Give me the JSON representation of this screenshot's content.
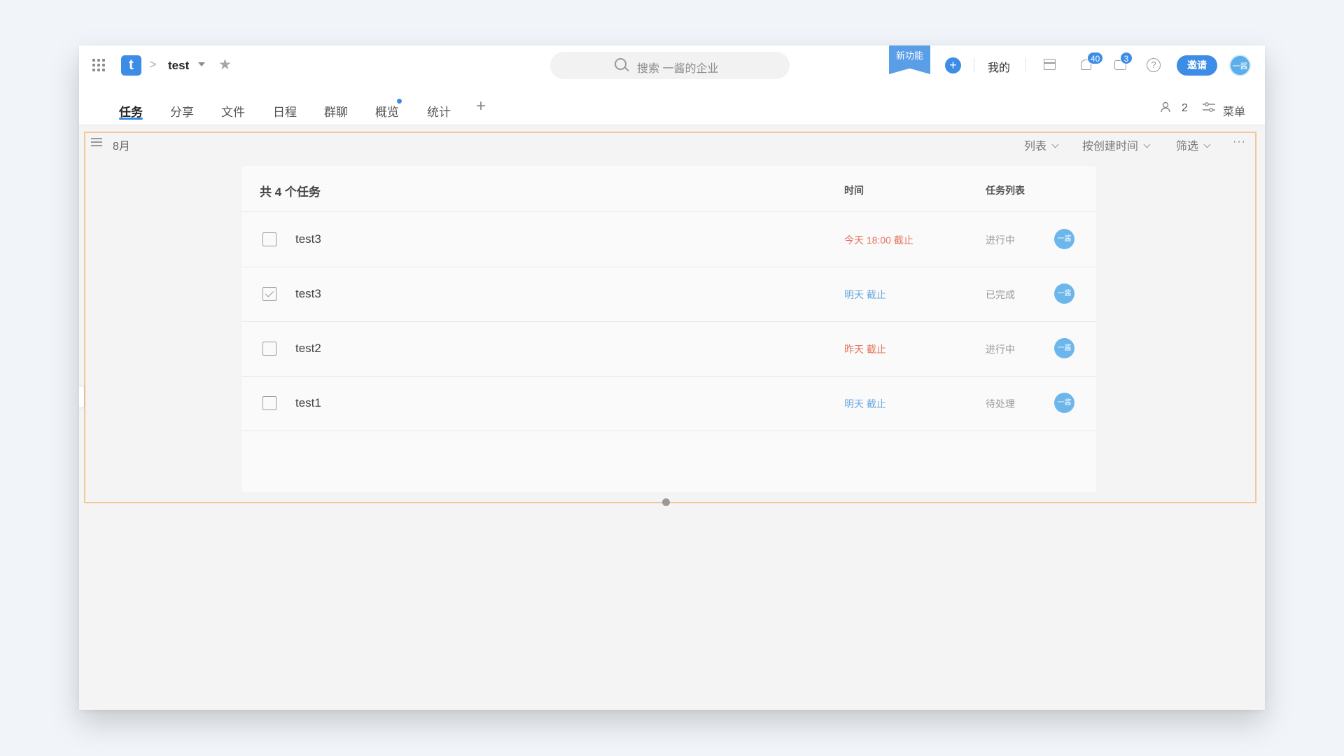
{
  "header": {
    "logo_letter": "t",
    "breadcrumb_separator": ">",
    "project_name": "test",
    "search_placeholder": "搜索 一酱的企业",
    "new_feature_label": "新功能",
    "add_label": "+",
    "mine_label": "我的",
    "notification_count": "40",
    "message_count": "3",
    "help_label": "?",
    "invite_label": "邀请",
    "avatar_text": "一酱"
  },
  "nav": {
    "tabs": [
      {
        "label": "任务",
        "active": true
      },
      {
        "label": "分享"
      },
      {
        "label": "文件"
      },
      {
        "label": "日程"
      },
      {
        "label": "群聊"
      },
      {
        "label": "概览",
        "has_dot": true
      },
      {
        "label": "统计"
      }
    ],
    "add_tab_label": "+",
    "member_count": "2",
    "menu_label": "菜单"
  },
  "toolbar": {
    "month": "8月",
    "view_label": "列表",
    "sort_label": "按创建时间",
    "filter_label": "筛选",
    "more_label": "···"
  },
  "task_table": {
    "count_label": "共 4 个任务",
    "columns": {
      "time": "时间",
      "list": "任务列表"
    },
    "rows": [
      {
        "title": "test3",
        "checked": false,
        "time": "今天 18:00 截止",
        "time_color": "#e8735c",
        "status": "进行中",
        "assignee": "一酱"
      },
      {
        "title": "test3",
        "checked": true,
        "time": "明天 截止",
        "time_color": "#6aa8e0",
        "status": "已完成",
        "assignee": "一酱"
      },
      {
        "title": "test2",
        "checked": false,
        "time": "昨天 截止",
        "time_color": "#e8735c",
        "status": "进行中",
        "assignee": "一酱"
      },
      {
        "title": "test1",
        "checked": false,
        "time": "明天 截止",
        "time_color": "#6aa8e0",
        "status": "待处理",
        "assignee": "一酱"
      }
    ]
  },
  "colors": {
    "accent": "#3d8ce6",
    "overdue": "#e8735c",
    "upcoming": "#6aa8e0",
    "highlight_border": "#f3c69c"
  },
  "icons": [
    "apps-grid-icon",
    "star-icon",
    "search-icon",
    "calendar-icon",
    "bell-icon",
    "message-icon",
    "help-icon",
    "members-icon",
    "menu-settings-icon",
    "hamburger-icon",
    "chevron-down-icon"
  ]
}
